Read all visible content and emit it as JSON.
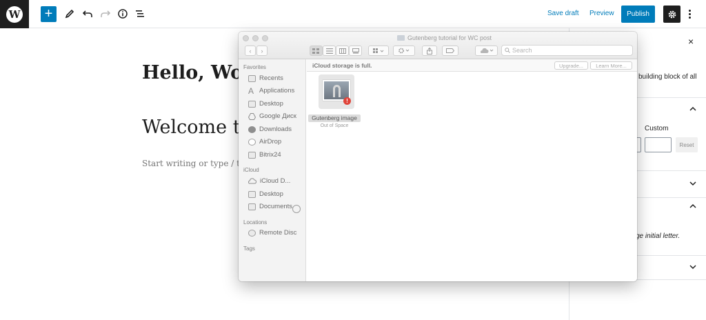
{
  "toolbar": {
    "logo": "W",
    "add_label": "+",
    "save_draft": "Save draft",
    "preview": "Preview",
    "publish": "Publish",
    "icons": [
      "wordpress-logo-icon",
      "plus-icon",
      "pencil-icon",
      "undo-icon",
      "redo-icon",
      "info-icon",
      "list-view-icon",
      "gear-icon",
      "more-vertical-icon"
    ]
  },
  "editor": {
    "title": "Hello, Wor",
    "heading": "Welcome to",
    "placeholder": "Start writing or type / to ch"
  },
  "sidebar": {
    "close": "×",
    "text1": "building block of all",
    "custom_label": "Custom",
    "reset_label": "Reset",
    "italic_text": "ge initial letter."
  },
  "finder": {
    "title": "Gutenberg tutorial for WC post",
    "search_placeholder": "Search",
    "banner": "iCloud storage is full.",
    "upgrade": "Upgrade...",
    "learn_more": "Learn More...",
    "sidebar": {
      "favorites_header": "Favorites",
      "favorites": [
        "Recents",
        "Applications",
        "Desktop",
        "Google Диск",
        "Downloads",
        "AirDrop",
        "Bitrix24"
      ],
      "icloud_header": "iCloud",
      "icloud": [
        "iCloud D...",
        "Desktop",
        "Documents"
      ],
      "locations_header": "Locations",
      "locations": [
        "Remote Disc"
      ],
      "tags_header": "Tags"
    },
    "file": {
      "name": "Gutenberg image",
      "status": "Out of Space",
      "alert": "!"
    }
  }
}
